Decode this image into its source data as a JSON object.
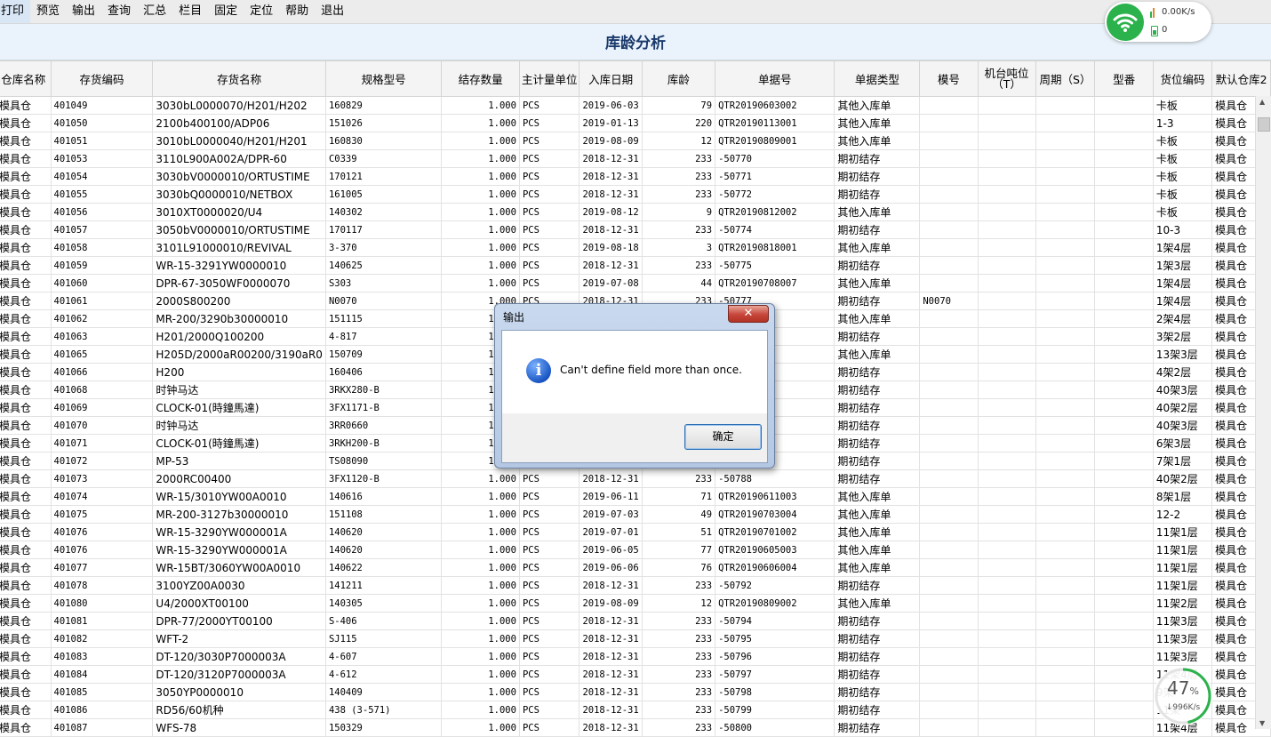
{
  "menu": [
    "打印",
    "预览",
    "输出",
    "查询",
    "汇总",
    "栏目",
    "固定",
    "定位",
    "帮助",
    "退出"
  ],
  "title": "库龄分析",
  "columns": [
    "仓库名称",
    "存货编码",
    "存货名称",
    "规格型号",
    "结存数量",
    "主计量单位",
    "入库日期",
    "库龄",
    "单据号",
    "单据类型",
    "模号",
    "机台吨位（T）",
    "周期（S）",
    "型番",
    "货位编码",
    "默认仓库2"
  ],
  "rows": [
    [
      "模具仓",
      "401049",
      "3030bL0000070/H201/H202",
      "160829",
      "1.000",
      "PCS",
      "2019-06-03",
      "79",
      "QTR20190603002",
      "其他入库单",
      "",
      "",
      "",
      "",
      "卡板",
      "模具仓"
    ],
    [
      "模具仓",
      "401050",
      "2100b400100/ADP06",
      "151026",
      "1.000",
      "PCS",
      "2019-01-13",
      "220",
      "QTR20190113001",
      "其他入库单",
      "",
      "",
      "",
      "",
      "1-3",
      "模具仓"
    ],
    [
      "模具仓",
      "401051",
      "3010bL0000040/H201/H201",
      "160830",
      "1.000",
      "PCS",
      "2019-08-09",
      "12",
      "QTR20190809001",
      "其他入库单",
      "",
      "",
      "",
      "",
      "卡板",
      "模具仓"
    ],
    [
      "模具仓",
      "401053",
      "3110L900A002A/DPR-60",
      "C0339",
      "1.000",
      "PCS",
      "2018-12-31",
      "233",
      "-50770",
      "期初结存",
      "",
      "",
      "",
      "",
      "卡板",
      "模具仓"
    ],
    [
      "模具仓",
      "401054",
      "3030bV0000010/ORTUSTIME",
      "170121",
      "1.000",
      "PCS",
      "2018-12-31",
      "233",
      "-50771",
      "期初结存",
      "",
      "",
      "",
      "",
      "卡板",
      "模具仓"
    ],
    [
      "模具仓",
      "401055",
      "3030bQ0000010/NETBOX",
      "161005",
      "1.000",
      "PCS",
      "2018-12-31",
      "233",
      "-50772",
      "期初结存",
      "",
      "",
      "",
      "",
      "卡板",
      "模具仓"
    ],
    [
      "模具仓",
      "401056",
      "3010XT0000020/U4",
      "140302",
      "1.000",
      "PCS",
      "2019-08-12",
      "9",
      "QTR20190812002",
      "其他入库单",
      "",
      "",
      "",
      "",
      "卡板",
      "模具仓"
    ],
    [
      "模具仓",
      "401057",
      "3050bV0000010/ORTUSTIME",
      "170117",
      "1.000",
      "PCS",
      "2018-12-31",
      "233",
      "-50774",
      "期初结存",
      "",
      "",
      "",
      "",
      "10-3",
      "模具仓"
    ],
    [
      "模具仓",
      "401058",
      "3101L91000010/REVIVAL",
      "3-370",
      "1.000",
      "PCS",
      "2019-08-18",
      "3",
      "QTR20190818001",
      "其他入库单",
      "",
      "",
      "",
      "",
      "1架4层",
      "模具仓"
    ],
    [
      "模具仓",
      "401059",
      "WR-15-3291YW0000010",
      "140625",
      "1.000",
      "PCS",
      "2018-12-31",
      "233",
      "-50775",
      "期初结存",
      "",
      "",
      "",
      "",
      "1架3层",
      "模具仓"
    ],
    [
      "模具仓",
      "401060",
      "DPR-67-3050WF0000070",
      "S303",
      "1.000",
      "PCS",
      "2019-07-08",
      "44",
      "QTR20190708007",
      "其他入库单",
      "",
      "",
      "",
      "",
      "1架4层",
      "模具仓"
    ],
    [
      "模具仓",
      "401061",
      "2000S800200",
      "N0070",
      "1.000",
      "PCS",
      "2018-12-31",
      "233",
      "-50777",
      "期初结存",
      "N0070",
      "",
      "",
      "",
      "1架4层",
      "模具仓"
    ],
    [
      "模具仓",
      "401062",
      "MR-200/3290b30000010",
      "151115",
      "1.000",
      "PCS",
      "",
      "",
      "",
      "其他入库单",
      "",
      "",
      "",
      "",
      "2架4层",
      "模具仓"
    ],
    [
      "模具仓",
      "401063",
      "H201/2000Q100200",
      "4-817",
      "1.000",
      "PCS",
      "",
      "",
      "",
      "期初结存",
      "",
      "",
      "",
      "",
      "3架2层",
      "模具仓"
    ],
    [
      "模具仓",
      "401065",
      "H205D/2000aR00200/3190aR0",
      "150709",
      "1.000",
      "PCS",
      "",
      "",
      "",
      "其他入库单",
      "",
      "",
      "",
      "",
      "13架3层",
      "模具仓"
    ],
    [
      "模具仓",
      "401066",
      "H200",
      "160406",
      "1.000",
      "PCS",
      "",
      "",
      "",
      "期初结存",
      "",
      "",
      "",
      "",
      "4架2层",
      "模具仓"
    ],
    [
      "模具仓",
      "401068",
      "时钟马达",
      "3RKX280-B",
      "1.000",
      "PCS",
      "",
      "",
      "",
      "期初结存",
      "",
      "",
      "",
      "",
      "40架3层",
      "模具仓"
    ],
    [
      "模具仓",
      "401069",
      "CLOCK-01(時鐘馬達)",
      "3FX1171-B",
      "1.000",
      "PCS",
      "",
      "",
      "",
      "期初结存",
      "",
      "",
      "",
      "",
      "40架2层",
      "模具仓"
    ],
    [
      "模具仓",
      "401070",
      "时钟马达",
      "3RR0660",
      "1.000",
      "PCS",
      "",
      "",
      "",
      "期初结存",
      "",
      "",
      "",
      "",
      "40架3层",
      "模具仓"
    ],
    [
      "模具仓",
      "401071",
      "CLOCK-01(時鐘馬達)",
      "3RKH200-B",
      "1.000",
      "PCS",
      "",
      "",
      "",
      "期初结存",
      "",
      "",
      "",
      "",
      "6架3层",
      "模具仓"
    ],
    [
      "模具仓",
      "401072",
      "MP-53",
      "TS08090",
      "1.000",
      "PCS",
      "",
      "",
      "",
      "期初结存",
      "",
      "",
      "",
      "",
      "7架1层",
      "模具仓"
    ],
    [
      "模具仓",
      "401073",
      "2000RC00400",
      "3FX1120-B",
      "1.000",
      "PCS",
      "2018-12-31",
      "233",
      "-50788",
      "期初结存",
      "",
      "",
      "",
      "",
      "40架2层",
      "模具仓"
    ],
    [
      "模具仓",
      "401074",
      "WR-15/3010YW00A0010",
      "140616",
      "1.000",
      "PCS",
      "2019-06-11",
      "71",
      "QTR20190611003",
      "其他入库单",
      "",
      "",
      "",
      "",
      "8架1层",
      "模具仓"
    ],
    [
      "模具仓",
      "401075",
      "MR-200-3127b30000010",
      "151108",
      "1.000",
      "PCS",
      "2019-07-03",
      "49",
      "QTR20190703004",
      "其他入库单",
      "",
      "",
      "",
      "",
      "12-2",
      "模具仓"
    ],
    [
      "模具仓",
      "401076",
      "WR-15-3290YW000001A",
      "140620",
      "1.000",
      "PCS",
      "2019-07-01",
      "51",
      "QTR20190701002",
      "其他入库单",
      "",
      "",
      "",
      "",
      "11架1层",
      "模具仓"
    ],
    [
      "模具仓",
      "401076",
      "WR-15-3290YW000001A",
      "140620",
      "1.000",
      "PCS",
      "2019-06-05",
      "77",
      "QTR20190605003",
      "其他入库单",
      "",
      "",
      "",
      "",
      "11架1层",
      "模具仓"
    ],
    [
      "模具仓",
      "401077",
      "WR-15BT/3060YW00A0010",
      "140622",
      "1.000",
      "PCS",
      "2019-06-06",
      "76",
      "QTR20190606004",
      "其他入库单",
      "",
      "",
      "",
      "",
      "11架1层",
      "模具仓"
    ],
    [
      "模具仓",
      "401078",
      "3100YZ00A0030",
      "141211",
      "1.000",
      "PCS",
      "2018-12-31",
      "233",
      "-50792",
      "期初结存",
      "",
      "",
      "",
      "",
      "11架1层",
      "模具仓"
    ],
    [
      "模具仓",
      "401080",
      "U4/2000XT00100",
      "140305",
      "1.000",
      "PCS",
      "2019-08-09",
      "12",
      "QTR20190809002",
      "其他入库单",
      "",
      "",
      "",
      "",
      "11架2层",
      "模具仓"
    ],
    [
      "模具仓",
      "401081",
      "DPR-77/2000YT00100",
      "S-406",
      "1.000",
      "PCS",
      "2018-12-31",
      "233",
      "-50794",
      "期初结存",
      "",
      "",
      "",
      "",
      "11架3层",
      "模具仓"
    ],
    [
      "模具仓",
      "401082",
      "WFT-2",
      "SJ115",
      "1.000",
      "PCS",
      "2018-12-31",
      "233",
      "-50795",
      "期初结存",
      "",
      "",
      "",
      "",
      "11架3层",
      "模具仓"
    ],
    [
      "模具仓",
      "401083",
      "DT-120/3030P7000003A",
      "4-607",
      "1.000",
      "PCS",
      "2018-12-31",
      "233",
      "-50796",
      "期初结存",
      "",
      "",
      "",
      "",
      "11架3层",
      "模具仓"
    ],
    [
      "模具仓",
      "401084",
      "DT-120/3120P7000003A",
      "4-612",
      "1.000",
      "PCS",
      "2018-12-31",
      "233",
      "-50797",
      "期初结存",
      "",
      "",
      "",
      "",
      "11架4层",
      "模具仓"
    ],
    [
      "模具仓",
      "401085",
      "3050YP0000010",
      "140409",
      "1.000",
      "PCS",
      "2018-12-31",
      "233",
      "-50798",
      "期初结存",
      "",
      "",
      "",
      "",
      "9架",
      "模具仓"
    ],
    [
      "模具仓",
      "401086",
      "RD56/60机种",
      "438 (3-571)",
      "1.000",
      "PCS",
      "2018-12-31",
      "233",
      "-50799",
      "期初结存",
      "",
      "",
      "",
      "",
      "11架",
      "模具仓"
    ],
    [
      "模具仓",
      "401087",
      "WFS-78",
      "150329",
      "1.000",
      "PCS",
      "2018-12-31",
      "233",
      "-50800",
      "期初结存",
      "",
      "",
      "",
      "",
      "11架4层",
      "模具仓"
    ]
  ],
  "dialog": {
    "title": "输出",
    "close_glyph": "✕",
    "icon_glyph": "i",
    "message": "Can't define field more than once.",
    "ok_label": "确定"
  },
  "network": {
    "speed": "0.00K/s",
    "count": "0"
  },
  "progress": {
    "percent": "47",
    "percent_sign": "%",
    "value": 0.47,
    "speed": "↓996K/s"
  },
  "colors": {
    "accent_green": "#2bb24c",
    "title_blue": "#1b3a6b",
    "close_red": "#c7453a"
  }
}
